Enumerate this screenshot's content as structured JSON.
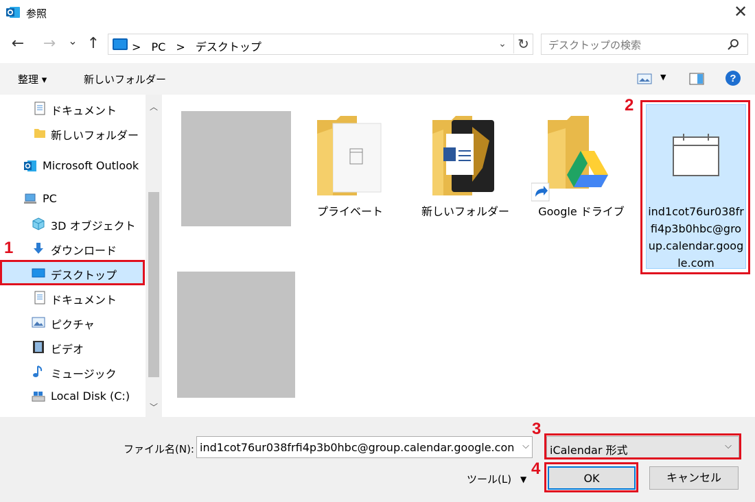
{
  "window": {
    "title": "参照",
    "close_glyph": "✕"
  },
  "nav": {
    "back": "←",
    "forward": "→",
    "recent": "⌄",
    "up": "↑",
    "address_parts": [
      "PC",
      "デスクトップ"
    ],
    "separator": ">",
    "refresh": "↻",
    "search_placeholder": "デスクトップの検索"
  },
  "toolbar": {
    "organize": "整理 ▾",
    "new_folder": "新しいフォルダー"
  },
  "sidebar": {
    "items": [
      {
        "label": "ドキュメント",
        "icon": "document-icon"
      },
      {
        "label": "新しいフォルダー",
        "icon": "folder-icon"
      },
      {
        "label": "Microsoft Outlook",
        "icon": "outlook-icon"
      },
      {
        "label": "PC",
        "icon": "pc-icon"
      },
      {
        "label": "3D オブジェクト",
        "icon": "cube-icon"
      },
      {
        "label": "ダウンロード",
        "icon": "download-icon"
      },
      {
        "label": "デスクトップ",
        "icon": "desktop-icon",
        "selected": true
      },
      {
        "label": "ドキュメント",
        "icon": "document-icon"
      },
      {
        "label": "ピクチャ",
        "icon": "picture-icon"
      },
      {
        "label": "ビデオ",
        "icon": "video-icon"
      },
      {
        "label": "ミュージック",
        "icon": "music-icon"
      },
      {
        "label": "Local Disk (C:)",
        "icon": "disk-icon"
      }
    ]
  },
  "files": [
    {
      "label": "プライベート",
      "icon": "folder-calendar-icon"
    },
    {
      "label": "新しいフォルダー",
      "icon": "folder-word-icon"
    },
    {
      "label": "Google ドライブ",
      "icon": "google-drive-shortcut-icon"
    },
    {
      "label": "ind1cot76ur038frfi4p3b0hbc@group.calendar.google.com",
      "label_lines": [
        "ind1cot76ur038fr",
        "fi4p3b0hbc@gro",
        "up.calendar.goog",
        "le.com"
      ],
      "icon": "calendar-icon",
      "selected": true
    }
  ],
  "annotations": [
    "1",
    "2",
    "3",
    "4"
  ],
  "footer": {
    "filename_label": "ファイル名(N):",
    "filename_value": "ind1cot76ur038frfi4p3b0hbc@group.calendar.google.con",
    "type_value": "iCalendar 形式",
    "tools_label": "ツール(L)",
    "ok_label": "OK",
    "cancel_label": "キャンセル"
  },
  "colors": {
    "accent": "#0078d7",
    "selection": "#cce8ff",
    "annotation_red": "#e0101e"
  }
}
